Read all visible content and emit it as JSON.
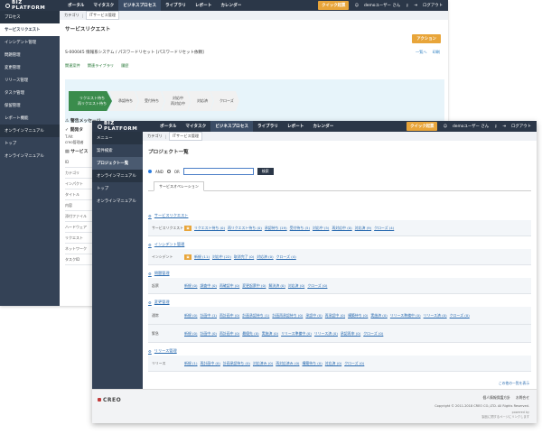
{
  "topbar": {
    "logo": "BIZ PLATFORM",
    "nav": [
      "ポータル",
      "マイタスク",
      "ビジネスプロセス",
      "ライブラリ",
      "レポート",
      "カレンダー"
    ],
    "quick_access": "クイック起票",
    "user": "demoユーザー さん",
    "logout": "ログアウト"
  },
  "back": {
    "sidebar": [
      "プロセス",
      "サービスリクエスト",
      "インシデント管理",
      "問題管理",
      "変更管理",
      "リリース管理",
      "タスク管理",
      "保留管理",
      "レポート機能",
      "オンラインマニュアル",
      "トップ",
      "オンラインマニュアル"
    ],
    "breadcrumb": [
      "カテゴリ",
      "ITサービス管理"
    ],
    "page_title": "サービスリクエスト",
    "action_button": "アクション",
    "record_title": "S-000045 情報系システム / パスワードリセット [パスワードリセット依頼]",
    "links": [
      "一覧へ",
      "印刷"
    ],
    "sub_links": [
      "関連案件",
      "関連ライブラリ",
      "履歴"
    ],
    "flow_steps": [
      {
        "label": "リクエスト待ち",
        "sub": "再リクエスト待ち"
      },
      {
        "label": "承認待ち",
        "sub": ""
      },
      {
        "label": "受付待ち",
        "sub": ""
      },
      {
        "label": "対応中",
        "sub": "再対応中"
      },
      {
        "label": "対応済",
        "sub": ""
      },
      {
        "label": "クローズ",
        "sub": ""
      }
    ],
    "alert_message": "警告メッセージ",
    "open_tasks": "開発タ",
    "tail_label": "T.Alt",
    "tail_sub": "creo管理者",
    "service_label": "サービス",
    "fields": [
      "ID",
      "カテゴリ",
      "インパクト",
      "タイトル",
      "内容",
      "添付ファイル",
      "ハードウェア",
      "リクエスト",
      "ネットワーク",
      "タスクID"
    ]
  },
  "front": {
    "sidebar": [
      "メニュー",
      "案件検索",
      "プロジェクト一覧",
      "オンラインマニュアル",
      "トップ",
      "オンラインマニュアル"
    ],
    "breadcrumb": [
      "カテゴリ",
      "ITサービス管理"
    ],
    "page_title": "プロジェクト一覧",
    "radio_and": "AND",
    "radio_or": "OR",
    "search_placeholder": "",
    "search_button": "検索",
    "tab": "サービスオペレーション",
    "groups": [
      {
        "title": "サービスリクエスト",
        "rows": [
          {
            "label": "サービスリクエスト",
            "icon": true,
            "items": [
              "リクエスト待ち (0)",
              "再リクエスト待ち (0)",
              "承認待ち (19)",
              "受付待ち (5)",
              "対応中 (5)",
              "再対応中 (0)",
              "対応済 (9)",
              "クローズ (4)"
            ]
          }
        ]
      },
      {
        "title": "インシデント管理",
        "rows": [
          {
            "label": "インシデント",
            "icon": true,
            "items": [
              "新規 (11)",
              "対応中 (22)",
              "取消完了 (0)",
              "対応済 (0)",
              "クローズ (4)"
            ]
          }
        ]
      },
      {
        "title": "問題管理",
        "rows": [
          {
            "label": "起票",
            "icon": false,
            "items": [
              "新規 (0)",
              "調査中 (0)",
              "再確認中 (0)",
              "変更起票中 (0)",
              "解決済 (0)",
              "対応済 (0)",
              "クローズ (0)"
            ]
          }
        ]
      },
      {
        "title": "変更管理",
        "rows": [
          {
            "label": "通常",
            "icon": false,
            "items": [
              "新規 (0)",
              "計画中 (1)",
              "再計画中 (0)",
              "計画承認待ち (1)",
              "計画再承認待ち (0)",
              "承認中 (0)",
              "再承認中 (0)",
              "構築待ち (0)",
              "実施済 (0)",
              "リリース準備中 (0)",
              "リリース済 (0)",
              "クローズ (0)"
            ]
          },
          {
            "label": "緊急",
            "icon": false,
            "items": [
              "新規 (0)",
              "計画中 (0)",
              "再計画中 (0)",
              "最優先 (0)",
              "実施済 (0)",
              "リリース準備中 (0)",
              "リリース済 (0)",
              "承認再申 (0)",
              "クローズ (0)"
            ]
          }
        ]
      },
      {
        "title": "リリース管理",
        "rows": [
          {
            "label": "リリース",
            "icon": false,
            "items": [
              "新規 (1)",
              "再計画中 (0)",
              "計画承認待ち (0)",
              "対応済み (0)",
              "再対応済み (0)",
              "構築待ち (0)",
              "対応済 (0)",
              "クローズ (0)"
            ]
          }
        ]
      }
    ],
    "more_link": "この他の一覧を表示",
    "footer": {
      "logo": "CREO",
      "links": [
        "個人情報保護方針",
        "お問合せ"
      ],
      "copyright": "Copyright © 2011-2018 CREO CO.,LTD. All Rights Reserved.",
      "powered": "powered by",
      "powered_sub": "製品に関するページにリンクします"
    }
  }
}
